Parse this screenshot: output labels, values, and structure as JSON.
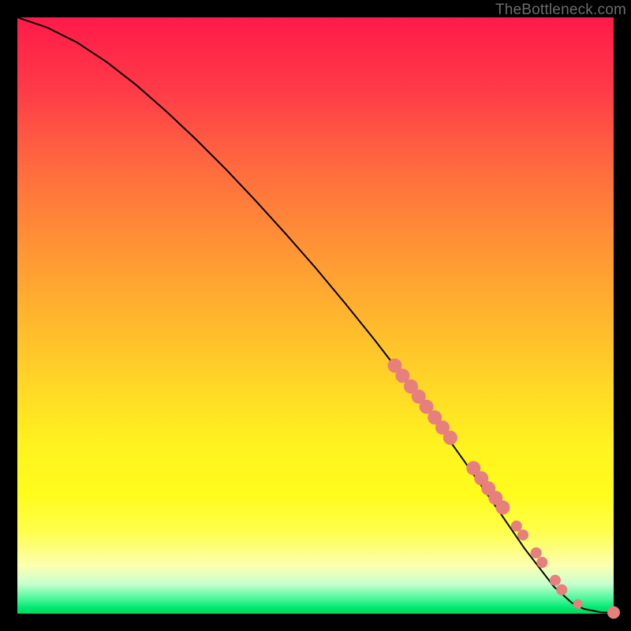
{
  "watermark": "TheBottleneck.com",
  "colors": {
    "point": "#e77f7c",
    "curve": "#000000",
    "background_top": "#ff1a49",
    "background_bottom": "#00d860"
  },
  "chart_data": {
    "type": "line",
    "title": "",
    "xlabel": "",
    "ylabel": "",
    "xlim": [
      0,
      100
    ],
    "ylim": [
      0,
      100
    ],
    "grid": false,
    "legend": false,
    "series": [
      {
        "name": "curve",
        "x": [
          0,
          5,
          10,
          15,
          20,
          25,
          30,
          35,
          40,
          45,
          50,
          55,
          60,
          65,
          70,
          75,
          80,
          85,
          90,
          93,
          95,
          98,
          100
        ],
        "y": [
          100,
          98.3,
          95.8,
          92.5,
          88.6,
          84.2,
          79.5,
          74.5,
          69.2,
          63.7,
          58.0,
          52.0,
          45.8,
          39.3,
          32.5,
          25.5,
          18.3,
          11.0,
          4.5,
          1.8,
          0.8,
          0.2,
          0.2
        ]
      },
      {
        "name": "points",
        "x": [
          63.3,
          64.6,
          66.0,
          67.3,
          68.6,
          70.0,
          71.3,
          72.6,
          76.5,
          77.8,
          79.0,
          80.2,
          81.4,
          83.7,
          84.8,
          87.0,
          88.0,
          90.2,
          91.3,
          94.0,
          100.0
        ],
        "y": [
          41.6,
          39.9,
          38.1,
          36.4,
          34.7,
          32.9,
          31.2,
          29.5,
          24.4,
          22.7,
          21.0,
          19.4,
          17.8,
          14.7,
          13.2,
          10.2,
          8.6,
          5.6,
          4.0,
          1.6,
          0.2
        ],
        "marker_radius": [
          9,
          9,
          9,
          9,
          9,
          9,
          9,
          9,
          9,
          9,
          9,
          9,
          9,
          7,
          7,
          7,
          7,
          7,
          7,
          6,
          8
        ]
      }
    ]
  }
}
